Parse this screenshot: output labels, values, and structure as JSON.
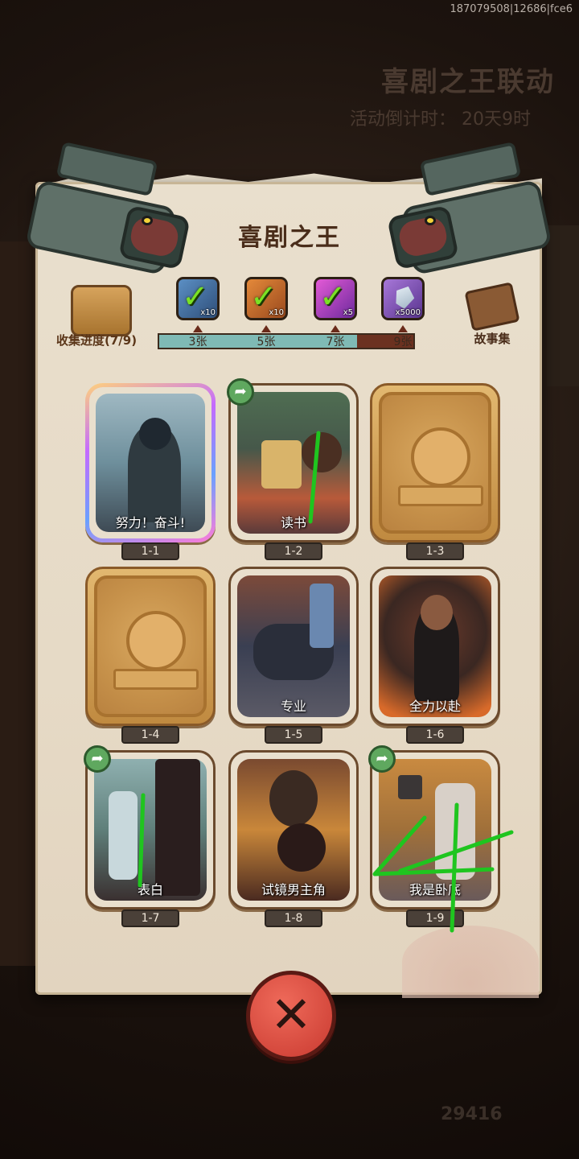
{
  "build_id": "187079508|12686|fce6",
  "background": {
    "event_title": "喜剧之王联动",
    "countdown": "活动倒计时： 20天9时",
    "count": "29416"
  },
  "panel": {
    "title": "喜剧之王",
    "collect_label": "收集进度(7/9)",
    "story_label": "故事集",
    "progress": {
      "collected": 7,
      "total": 9
    },
    "rewards": [
      {
        "qty": "x10",
        "claimed": true,
        "icon": "blue-chest-icon",
        "threshold": "3张"
      },
      {
        "qty": "x10",
        "claimed": true,
        "icon": "orange-chest-icon",
        "threshold": "5张"
      },
      {
        "qty": "x5",
        "claimed": true,
        "icon": "rainbow-orb-icon",
        "threshold": "7张"
      },
      {
        "qty": "x5000",
        "claimed": false,
        "icon": "crystal-icon",
        "threshold": "9张"
      }
    ]
  },
  "cards": [
    {
      "id": "1-1",
      "title": "努力！奋斗!",
      "state": "rare"
    },
    {
      "id": "1-2",
      "title": "读书",
      "state": "unlocked",
      "share": true
    },
    {
      "id": "1-3",
      "title": "",
      "state": "locked"
    },
    {
      "id": "1-4",
      "title": "",
      "state": "locked"
    },
    {
      "id": "1-5",
      "title": "专业",
      "state": "unlocked"
    },
    {
      "id": "1-6",
      "title": "全力以赴",
      "state": "unlocked"
    },
    {
      "id": "1-7",
      "title": "表白",
      "state": "unlocked",
      "share": true
    },
    {
      "id": "1-8",
      "title": "试镜男主角",
      "state": "unlocked"
    },
    {
      "id": "1-9",
      "title": "我是卧底",
      "state": "unlocked",
      "share": true
    }
  ],
  "colors": {
    "parchment": "#e9dfcd",
    "title_brown": "#4a2d1a",
    "progress_teal": "#7fbab5",
    "progress_track": "#6b3120",
    "check_green": "#7ae224",
    "close_red": "#d9473a",
    "annotation_green": "#1fc51f"
  }
}
